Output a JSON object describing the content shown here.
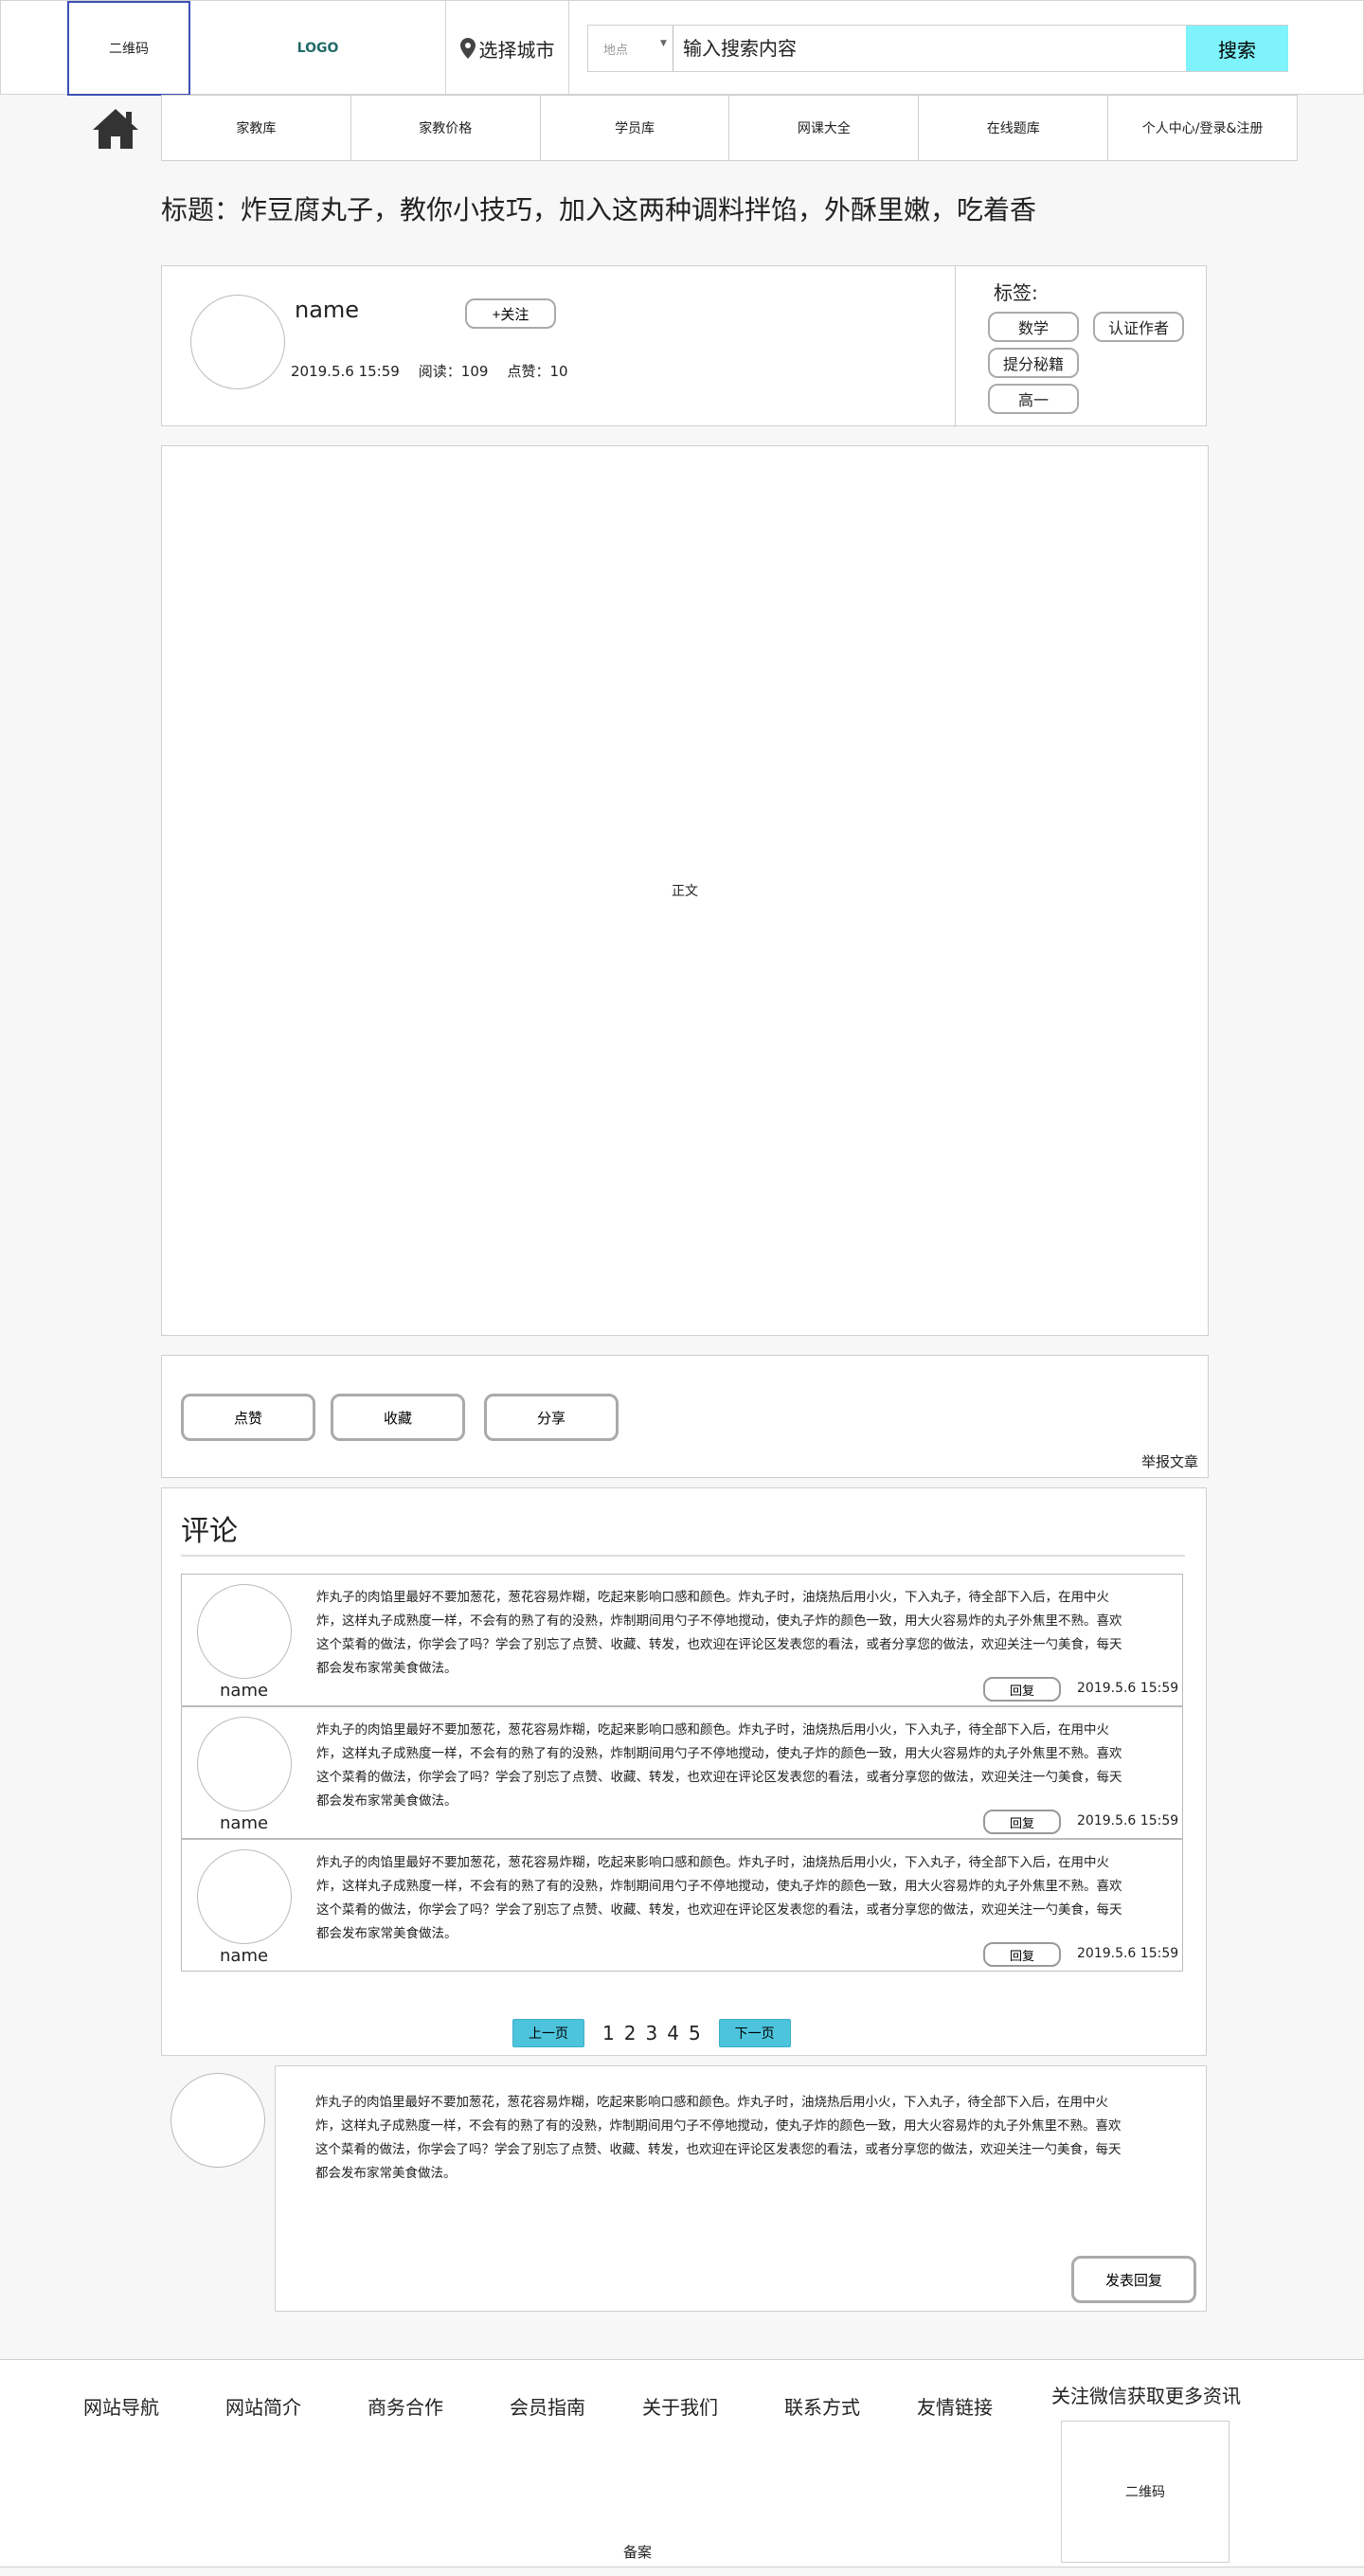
{
  "header": {
    "qr_label": "二维码",
    "logo": "LOGO",
    "city_label": "选择城市",
    "location_select": "地点",
    "search_placeholder": "输入搜索内容",
    "search_button": "搜索"
  },
  "nav": {
    "items": [
      "家教库",
      "家教价格",
      "学员库",
      "网课大全",
      "在线题库",
      "个人中心/登录&注册"
    ]
  },
  "article": {
    "title": "标题：炸豆腐丸子，教你小技巧，加入这两种调料拌馅，外酥里嫩，吃着香",
    "author_name": "name",
    "follow_button": "+关注",
    "date": "2019.5.6 15:59",
    "reads": "阅读：109",
    "likes": "点赞：10",
    "tags_label": "标签:",
    "tags": [
      "数学",
      "认证作者",
      "提分秘籍",
      "高一"
    ],
    "body": "正文"
  },
  "actions": {
    "like": "点赞",
    "collect": "收藏",
    "share": "分享",
    "report": "举报文章"
  },
  "comments": {
    "title": "评论",
    "items": [
      {
        "name": "name",
        "text": "炸丸子的肉馅里最好不要加葱花，葱花容易炸糊，吃起来影响口感和颜色。炸丸子时，油烧热后用小火，下入丸子，待全部下入后，在用中火炸，这样丸子成熟度一样，不会有的熟了有的没熟，炸制期间用勺子不停地搅动，使丸子炸的颜色一致，用大火容易炸的丸子外焦里不熟。喜欢这个菜肴的做法，你学会了吗？学会了别忘了点赞、收藏、转发，也欢迎在评论区发表您的看法，或者分享您的做法，欢迎关注一勺美食，每天都会发布家常美食做法。",
        "reply": "回复",
        "time": "2019.5.6 15:59"
      },
      {
        "name": "name",
        "text": "炸丸子的肉馅里最好不要加葱花，葱花容易炸糊，吃起来影响口感和颜色。炸丸子时，油烧热后用小火，下入丸子，待全部下入后，在用中火炸，这样丸子成熟度一样，不会有的熟了有的没熟，炸制期间用勺子不停地搅动，使丸子炸的颜色一致，用大火容易炸的丸子外焦里不熟。喜欢这个菜肴的做法，你学会了吗？学会了别忘了点赞、收藏、转发，也欢迎在评论区发表您的看法，或者分享您的做法，欢迎关注一勺美食，每天都会发布家常美食做法。",
        "reply": "回复",
        "time": "2019.5.6 15:59"
      },
      {
        "name": "name",
        "text": "炸丸子的肉馅里最好不要加葱花，葱花容易炸糊，吃起来影响口感和颜色。炸丸子时，油烧热后用小火，下入丸子，待全部下入后，在用中火炸，这样丸子成熟度一样，不会有的熟了有的没熟，炸制期间用勺子不停地搅动，使丸子炸的颜色一致，用大火容易炸的丸子外焦里不熟。喜欢这个菜肴的做法，你学会了吗？学会了别忘了点赞、收藏、转发，也欢迎在评论区发表您的看法，或者分享您的做法，欢迎关注一勺美食，每天都会发布家常美食做法。",
        "reply": "回复",
        "time": "2019.5.6 15:59"
      }
    ],
    "pager": {
      "prev": "上一页",
      "pages": [
        "1",
        "2",
        "3",
        "4",
        "5"
      ],
      "next": "下一页"
    }
  },
  "reply_box": {
    "text": "炸丸子的肉馅里最好不要加葱花，葱花容易炸糊，吃起来影响口感和颜色。炸丸子时，油烧热后用小火，下入丸子，待全部下入后，在用中火炸，这样丸子成熟度一样，不会有的熟了有的没熟，炸制期间用勺子不停地搅动，使丸子炸的颜色一致，用大火容易炸的丸子外焦里不熟。喜欢这个菜肴的做法，你学会了吗？学会了别忘了点赞、收藏、转发，也欢迎在评论区发表您的看法，或者分享您的做法，欢迎关注一勺美食，每天都会发布家常美食做法。",
    "submit": "发表回复"
  },
  "footer": {
    "links": [
      "网站导航",
      "网站简介",
      "商务合作",
      "会员指南",
      "关于我们",
      "联系方式",
      "友情链接"
    ],
    "wechat": "关注微信获取更多资讯",
    "qr_label": "二维码",
    "record": "备案"
  },
  "colors": {
    "search_button": "#7ef3fb",
    "pager_button": "#4dc4dc",
    "qr_border": "#3b4fb8"
  }
}
